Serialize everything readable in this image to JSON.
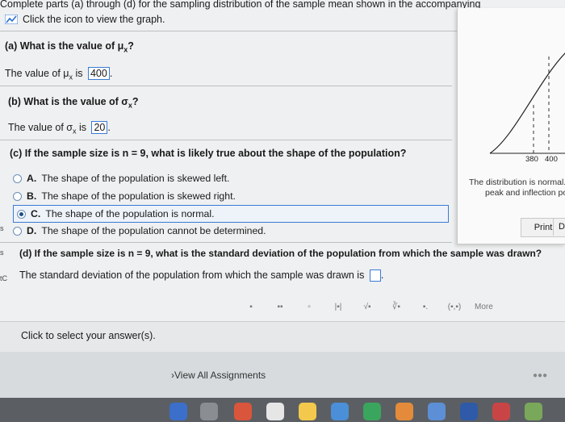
{
  "header": {
    "instructions": "Complete parts (a) through (d) for the sampling distribution of the sample mean shown in the accompanying",
    "graph_link": "Click the icon to view the graph."
  },
  "part_a": {
    "question": "(a) What is the value of μ",
    "question_sub": "x",
    "question_end": "?",
    "answer_prefix": "The value of μ",
    "answer_sub": "x",
    "answer_mid": "is",
    "answer_value": "400",
    "answer_end": "."
  },
  "part_b": {
    "question": "(b) What is the value of σ",
    "question_sub": "x",
    "question_end": "?",
    "answer_prefix": "The value of σ",
    "answer_sub": "x",
    "answer_mid": "is",
    "answer_value": "20",
    "answer_end": "."
  },
  "part_c": {
    "question": "(c) If the sample size is n = 9, what is likely true about the shape of the population?",
    "options": [
      {
        "letter": "A.",
        "text": "The shape of the population is skewed left.",
        "selected": false
      },
      {
        "letter": "B.",
        "text": "The shape of the population is skewed right.",
        "selected": false
      },
      {
        "letter": "C.",
        "text": "The shape of the population is normal.",
        "selected": true
      },
      {
        "letter": "D.",
        "text": "The shape of the population cannot be determined.",
        "selected": false
      }
    ]
  },
  "part_d": {
    "question": "(d) If the sample size is n = 9, what is the standard deviation of the population from which the sample was drawn?",
    "answer_prefix": "The standard deviation of the population from which the sample was drawn is",
    "answer_end": "."
  },
  "graph_popup": {
    "tick_labels": [
      "380",
      "400"
    ],
    "caption_line1": "The distribution is normal.",
    "caption_line2": "peak and inflection po",
    "print_label": "Print",
    "side_label": "D"
  },
  "toolbar": {
    "items": [
      "▪",
      "▪▪",
      "▫",
      "|▪|",
      "√▪",
      "∛▪",
      "▪.",
      "(▪,▪)",
      "More"
    ]
  },
  "status": {
    "prompt": "Click to select your answer(s)."
  },
  "footer": {
    "link": "View All Assignments"
  },
  "colors": {
    "accent": "#3a7bd5",
    "selected_fill": "#1d4e89"
  }
}
